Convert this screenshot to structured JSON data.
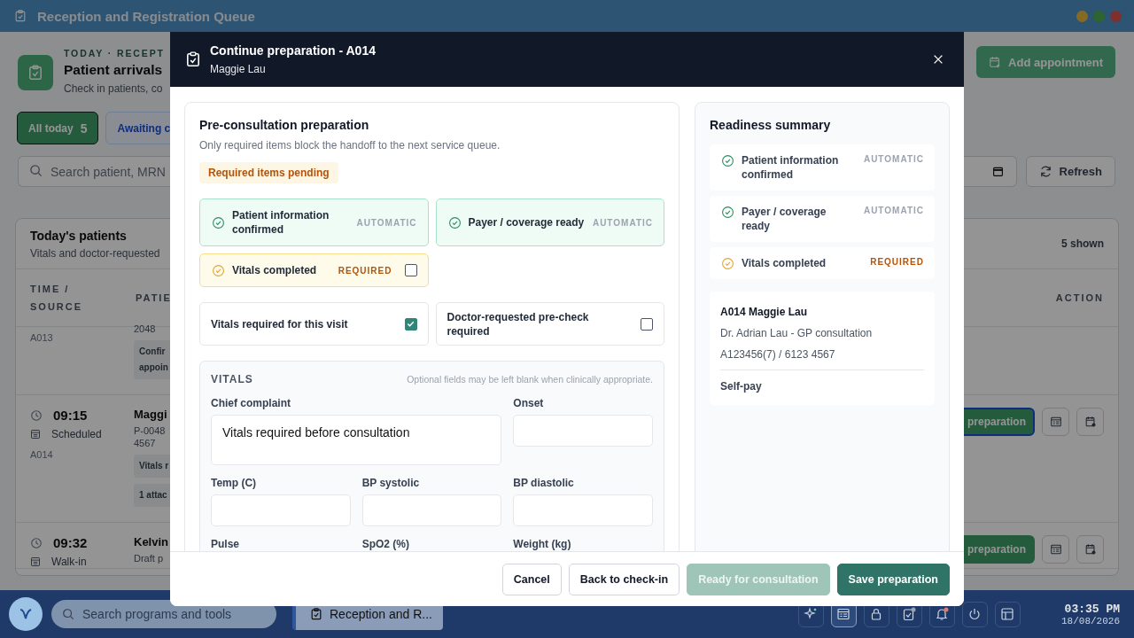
{
  "window": {
    "title": "Reception and Registration Queue"
  },
  "page": {
    "eyebrow": "TODAY · RECEPT",
    "title": "Patient arrivals",
    "subtitle": "Check in patients, co",
    "add_button": "Add appointment"
  },
  "tabs": [
    {
      "label": "All today",
      "count": "5",
      "selected": true
    },
    {
      "label": "Awaiting c",
      "selected": false
    }
  ],
  "search": {
    "placeholder": "Search patient, MRN"
  },
  "refresh_button": "Refresh",
  "table": {
    "title": "Today's patients",
    "subtitle": "Vitals and doctor-requested",
    "count": "5 shown",
    "columns": [
      "TIME / SOURCE",
      "PATIE",
      "ACTION"
    ],
    "rows": [
      {
        "ref": "A013",
        "lines": [
          "2048"
        ],
        "tags": [
          {
            "lines": [
              "Confir",
              "appoin"
            ]
          }
        ]
      },
      {
        "time": "09:15",
        "source": "Scheduled",
        "ref": "A014",
        "name": "Maggi",
        "lines": [
          "P-0048",
          "4567"
        ],
        "tags": [
          {
            "lines": [
              "Vitals r"
            ]
          },
          {
            "lines": [
              "1 attac"
            ]
          }
        ],
        "action": "preparation",
        "focused": true
      },
      {
        "time": "09:32",
        "source": "Walk-in",
        "name": "Kelvin",
        "lines": [
          "Draft p"
        ],
        "action": "preparation",
        "focused": false
      }
    ]
  },
  "dialog": {
    "title": "Continue preparation - A014",
    "subtitle": "Maggie Lau",
    "preparation": {
      "title": "Pre-consultation preparation",
      "subtitle": "Only required items block the handoff to the next service queue.",
      "status_badge": "Required items pending",
      "checklist": [
        {
          "label": "Patient information confirmed",
          "kind": "automatic",
          "tag": "AUTOMATIC",
          "done": true
        },
        {
          "label": "Payer / coverage ready",
          "kind": "automatic",
          "tag": "AUTOMATIC",
          "done": true
        },
        {
          "label": "Vitals completed",
          "kind": "required",
          "tag": "REQUIRED",
          "done": false,
          "checked": false
        }
      ],
      "options": [
        {
          "label": "Vitals required for this visit",
          "checked": true
        },
        {
          "label": "Doctor-requested pre-check required",
          "checked": false
        }
      ],
      "vitals": {
        "title": "VITALS",
        "note": "Optional fields may be left blank when clinically appropriate.",
        "fields": [
          {
            "label": "Chief complaint",
            "kind": "textarea",
            "value": "Vitals required before consultation"
          },
          {
            "label": "Onset",
            "kind": "input"
          },
          {
            "label": "Temp (C)",
            "kind": "input"
          },
          {
            "label": "BP systolic",
            "kind": "input"
          },
          {
            "label": "BP diastolic",
            "kind": "input"
          },
          {
            "label": "Pulse"
          },
          {
            "label": "SpO2 (%)"
          },
          {
            "label": "Weight (kg)"
          }
        ]
      }
    },
    "summary": {
      "title": "Readiness summary",
      "items": [
        {
          "label": "Patient information confirmed",
          "tag": "AUTOMATIC",
          "kind": "automatic",
          "done": true
        },
        {
          "label": "Payer / coverage ready",
          "tag": "AUTOMATIC",
          "kind": "automatic",
          "done": true
        },
        {
          "label": "Vitals completed",
          "tag": "REQUIRED",
          "kind": "required",
          "done": false
        }
      ],
      "patient": {
        "name": "A014 Maggie Lau",
        "lines": [
          "Dr. Adrian Lau - GP consultation",
          "A123456(7) / 6123 4567"
        ],
        "payer": "Self-pay"
      }
    },
    "buttons": [
      {
        "label": "Cancel",
        "kind": "secondary",
        "disabled": false
      },
      {
        "label": "Back to check-in",
        "kind": "secondary",
        "disabled": false
      },
      {
        "label": "Ready for consultation",
        "kind": "primary",
        "disabled": true
      },
      {
        "label": "Save preparation",
        "kind": "primary",
        "disabled": false
      }
    ]
  },
  "taskbar": {
    "search_placeholder": "Search programs and tools",
    "task": "Reception and R...",
    "time": "03:35 PM",
    "date": "18/08/2026"
  }
}
